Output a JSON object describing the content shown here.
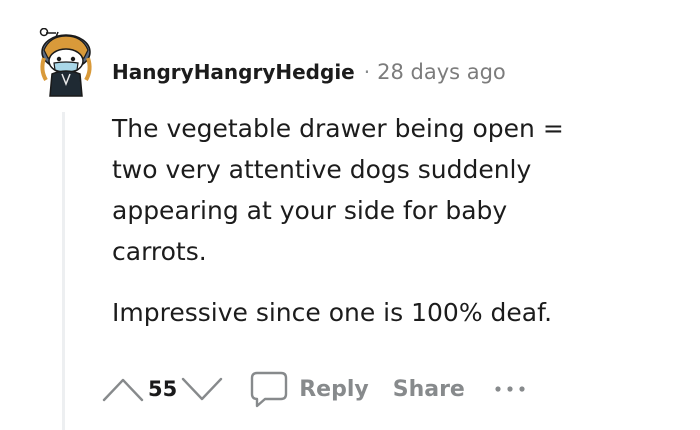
{
  "comment": {
    "author": "HangryHangryHedgie",
    "separator": "·",
    "timestamp": "28 days ago",
    "paragraphs": [
      "The vegetable drawer being open = two very attentive dogs suddenly appearing at your side for baby carrots.",
      "Impressive since one is 100% deaf."
    ]
  },
  "actions": {
    "score": "55",
    "reply_label": "Reply",
    "share_label": "Share"
  },
  "icons": {
    "upvote": "upvote-arrow-icon",
    "downvote": "downvote-arrow-icon",
    "reply": "speech-bubble-icon",
    "more": "ellipsis-icon",
    "avatar": "snoo-avatar"
  },
  "colors": {
    "text": "#1c1c1c",
    "muted": "#878a8c",
    "thread_line": "#edeff1"
  }
}
